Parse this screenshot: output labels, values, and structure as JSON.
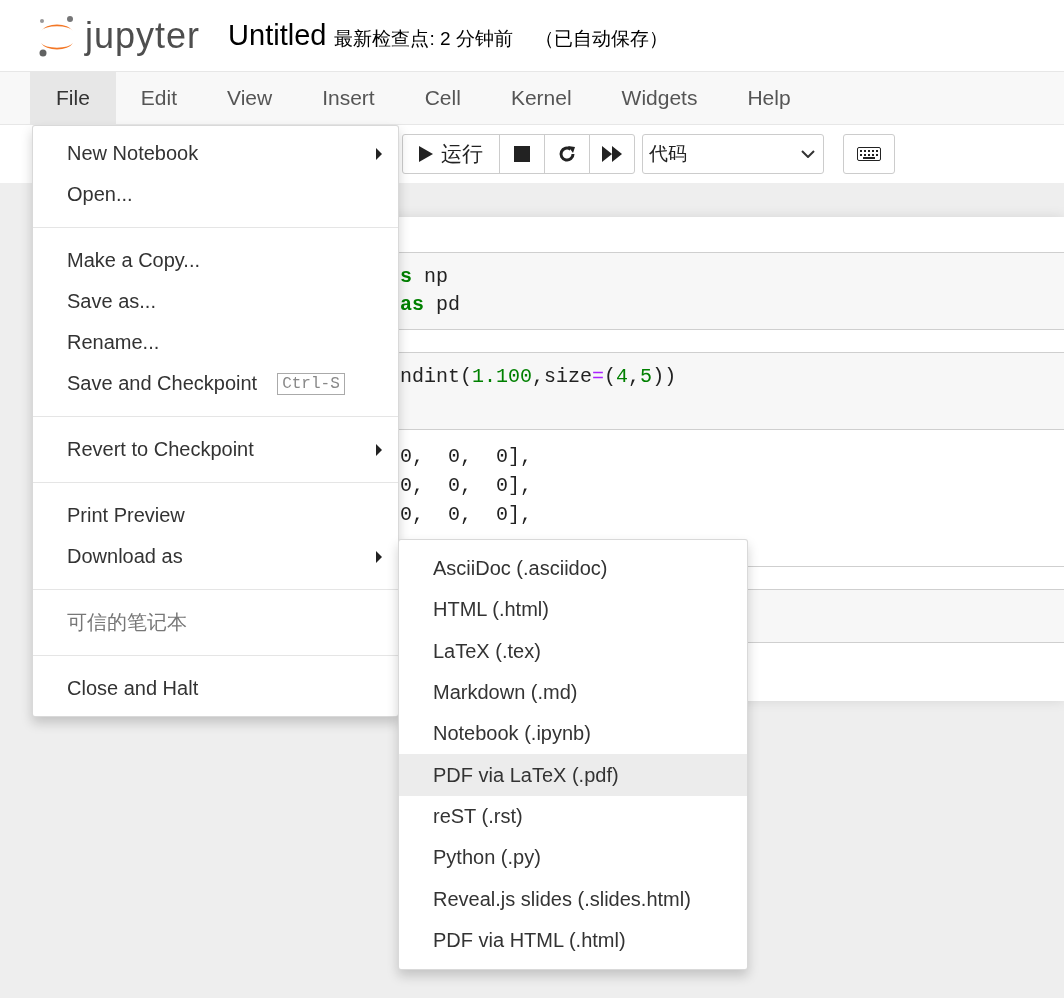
{
  "header": {
    "logo_text": "jupyter",
    "notebook_name": "Untitled",
    "checkpoint": "最新检查点: 2 分钟前",
    "autosave": "（已自动保存）"
  },
  "menubar": [
    {
      "label": "File",
      "selected": true
    },
    {
      "label": "Edit",
      "selected": false
    },
    {
      "label": "View",
      "selected": false
    },
    {
      "label": "Insert",
      "selected": false
    },
    {
      "label": "Cell",
      "selected": false
    },
    {
      "label": "Kernel",
      "selected": false
    },
    {
      "label": "Widgets",
      "selected": false
    },
    {
      "label": "Help",
      "selected": false
    }
  ],
  "toolbar": {
    "run_label": "运行",
    "cell_type": "代码"
  },
  "cells": [
    {
      "kind": "code",
      "input": [
        [
          {
            "kind": "keyword",
            "text": "s"
          },
          {
            "kind": "plain",
            "text": " np"
          }
        ],
        [
          {
            "kind": "keyword",
            "text": "as"
          },
          {
            "kind": "plain",
            "text": " pd"
          }
        ]
      ]
    },
    {
      "kind": "code",
      "input": [
        [
          {
            "kind": "plain",
            "text": "ndint("
          },
          {
            "kind": "number",
            "text": "1.100"
          },
          {
            "kind": "plain",
            "text": ",size"
          },
          {
            "kind": "operator",
            "text": "="
          },
          {
            "kind": "plain",
            "text": "("
          },
          {
            "kind": "number",
            "text": "4"
          },
          {
            "kind": "plain",
            "text": ","
          },
          {
            "kind": "number",
            "text": "5"
          },
          {
            "kind": "plain",
            "text": "))"
          }
        ]
      ],
      "output": [
        "0,  0,  0],",
        "0,  0,  0],",
        "0,  0,  0],"
      ]
    },
    {
      "kind": "code"
    }
  ],
  "file_menu": {
    "sections": [
      [
        {
          "label": "New Notebook",
          "submenu": true,
          "disabled": false
        },
        {
          "label": "Open...",
          "submenu": false,
          "disabled": false
        }
      ],
      [
        {
          "label": "Make a Copy...",
          "submenu": false,
          "disabled": false
        },
        {
          "label": "Save as...",
          "submenu": false,
          "disabled": false
        },
        {
          "label": "Rename...",
          "submenu": false,
          "disabled": false
        },
        {
          "label": "Save and Checkpoint",
          "submenu": false,
          "disabled": false,
          "shortcut": "Ctrl-S"
        }
      ],
      [
        {
          "label": "Revert to Checkpoint",
          "submenu": true,
          "disabled": false
        }
      ],
      [
        {
          "label": "Print Preview",
          "submenu": false,
          "disabled": false
        },
        {
          "label": "Download as",
          "submenu": true,
          "disabled": false
        }
      ],
      [
        {
          "label": "可信的笔记本",
          "submenu": false,
          "disabled": true
        }
      ],
      [
        {
          "label": "Close and Halt",
          "submenu": false,
          "disabled": false
        }
      ]
    ]
  },
  "download_submenu": [
    {
      "label": "AsciiDoc (.asciidoc)",
      "selected": false
    },
    {
      "label": "HTML (.html)",
      "selected": false
    },
    {
      "label": "LaTeX (.tex)",
      "selected": false
    },
    {
      "label": "Markdown (.md)",
      "selected": false
    },
    {
      "label": "Notebook (.ipynb)",
      "selected": false
    },
    {
      "label": "PDF via LaTeX (.pdf)",
      "selected": true
    },
    {
      "label": "reST (.rst)",
      "selected": false
    },
    {
      "label": "Python (.py)",
      "selected": false
    },
    {
      "label": "Reveal.js slides (.slides.html)",
      "selected": false
    },
    {
      "label": "PDF via HTML (.html)",
      "selected": false
    }
  ]
}
